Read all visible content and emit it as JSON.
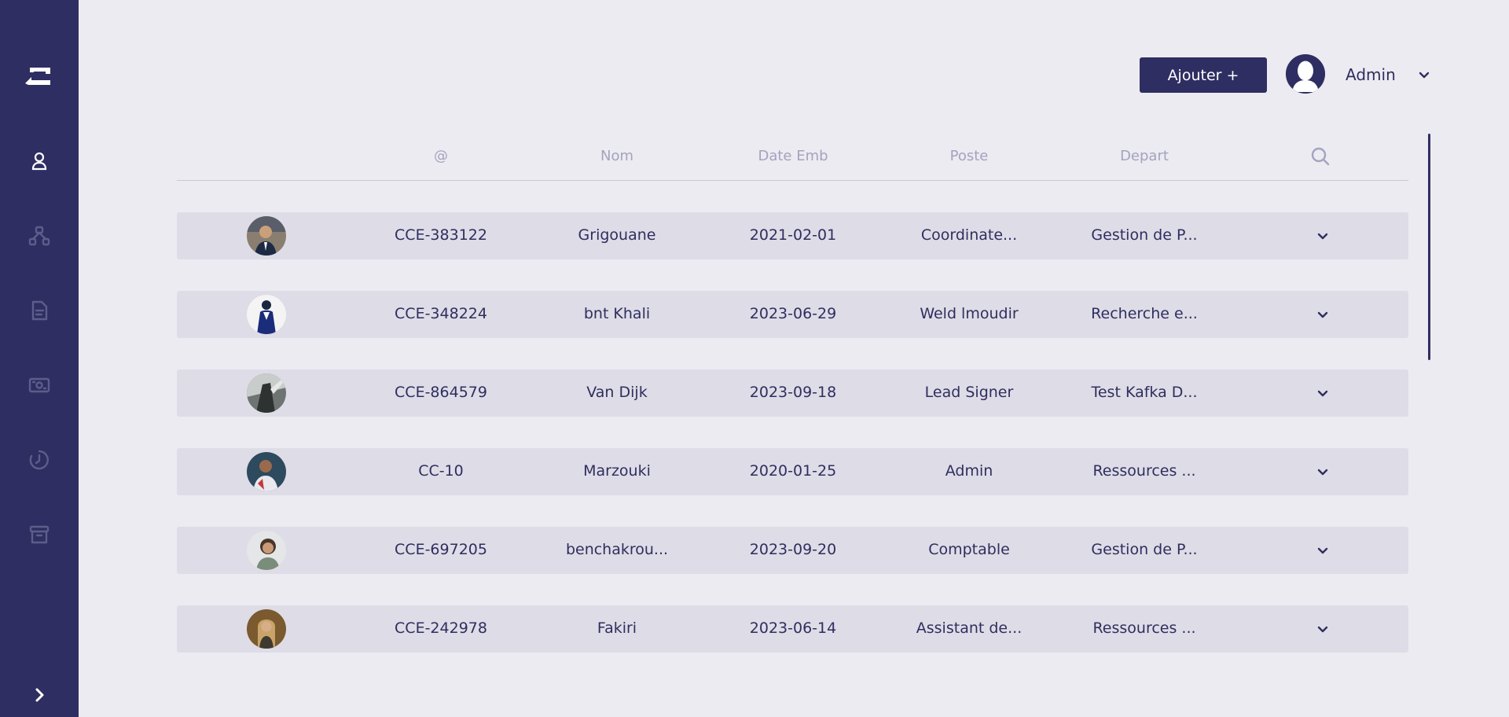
{
  "header": {
    "add_button_label": "Ajouter +",
    "user_name": "Admin"
  },
  "table": {
    "columns": [
      "@",
      "Nom",
      "Date Emb",
      "Poste",
      "Depart"
    ],
    "rows": [
      {
        "id": "CCE-383122",
        "nom": "Grigouane",
        "date_emb": "2021-02-01",
        "poste": "Coordinate...",
        "depart": "Gestion de P..."
      },
      {
        "id": "CCE-348224",
        "nom": "bnt Khali",
        "date_emb": "2023-06-29",
        "poste": "Weld lmoudir",
        "depart": "Recherche e..."
      },
      {
        "id": "CCE-864579",
        "nom": "Van Dijk",
        "date_emb": "2023-09-18",
        "poste": "Lead Signer",
        "depart": "Test Kafka D..."
      },
      {
        "id": "CC-10",
        "nom": "Marzouki",
        "date_emb": "2020-01-25",
        "poste": "Admin",
        "depart": "Ressources ..."
      },
      {
        "id": "CCE-697205",
        "nom": "benchakrou...",
        "date_emb": "2023-09-20",
        "poste": "Comptable",
        "depart": "Gestion de P..."
      },
      {
        "id": "CCE-242978",
        "nom": "Fakiri",
        "date_emb": "2023-06-14",
        "poste": "Assistant de...",
        "depart": "Ressources ..."
      }
    ]
  },
  "sidebar": {
    "items": [
      {
        "icon": "user-icon"
      },
      {
        "icon": "org-chart-icon"
      },
      {
        "icon": "document-icon"
      },
      {
        "icon": "payroll-icon"
      },
      {
        "icon": "time-icon"
      },
      {
        "icon": "archive-icon"
      }
    ]
  },
  "colors": {
    "sidebar_bg": "#2F2E62",
    "page_bg": "#ECEBF1",
    "row_bg": "#DEDCE6",
    "header_text": "#A4A3BF",
    "primary_text": "#2F2E5F",
    "button_bg": "#2F2E62"
  }
}
